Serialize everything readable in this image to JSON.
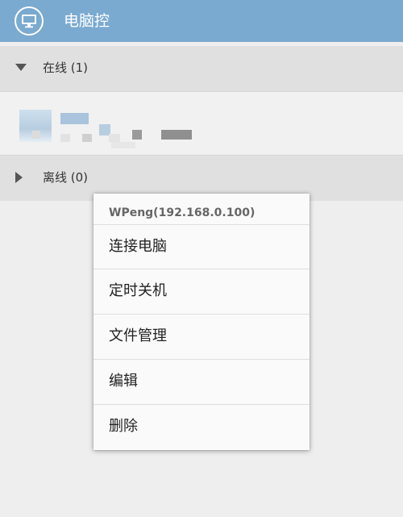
{
  "app_bar": {
    "title": "电脑控",
    "icon": "monitor-icon",
    "background": "#7aaad0"
  },
  "groups": {
    "online": {
      "label": "在线 (1)",
      "icon": "triangle-down-icon",
      "expanded": true
    },
    "offline": {
      "label": "离线 (0)",
      "icon": "triangle-right-icon",
      "expanded": false
    }
  },
  "context_menu": {
    "title": "WPeng(192.168.0.100)",
    "items": [
      {
        "label": "连接电脑"
      },
      {
        "label": "定时关机"
      },
      {
        "label": "文件管理"
      },
      {
        "label": "编辑"
      },
      {
        "label": "删除"
      }
    ]
  }
}
